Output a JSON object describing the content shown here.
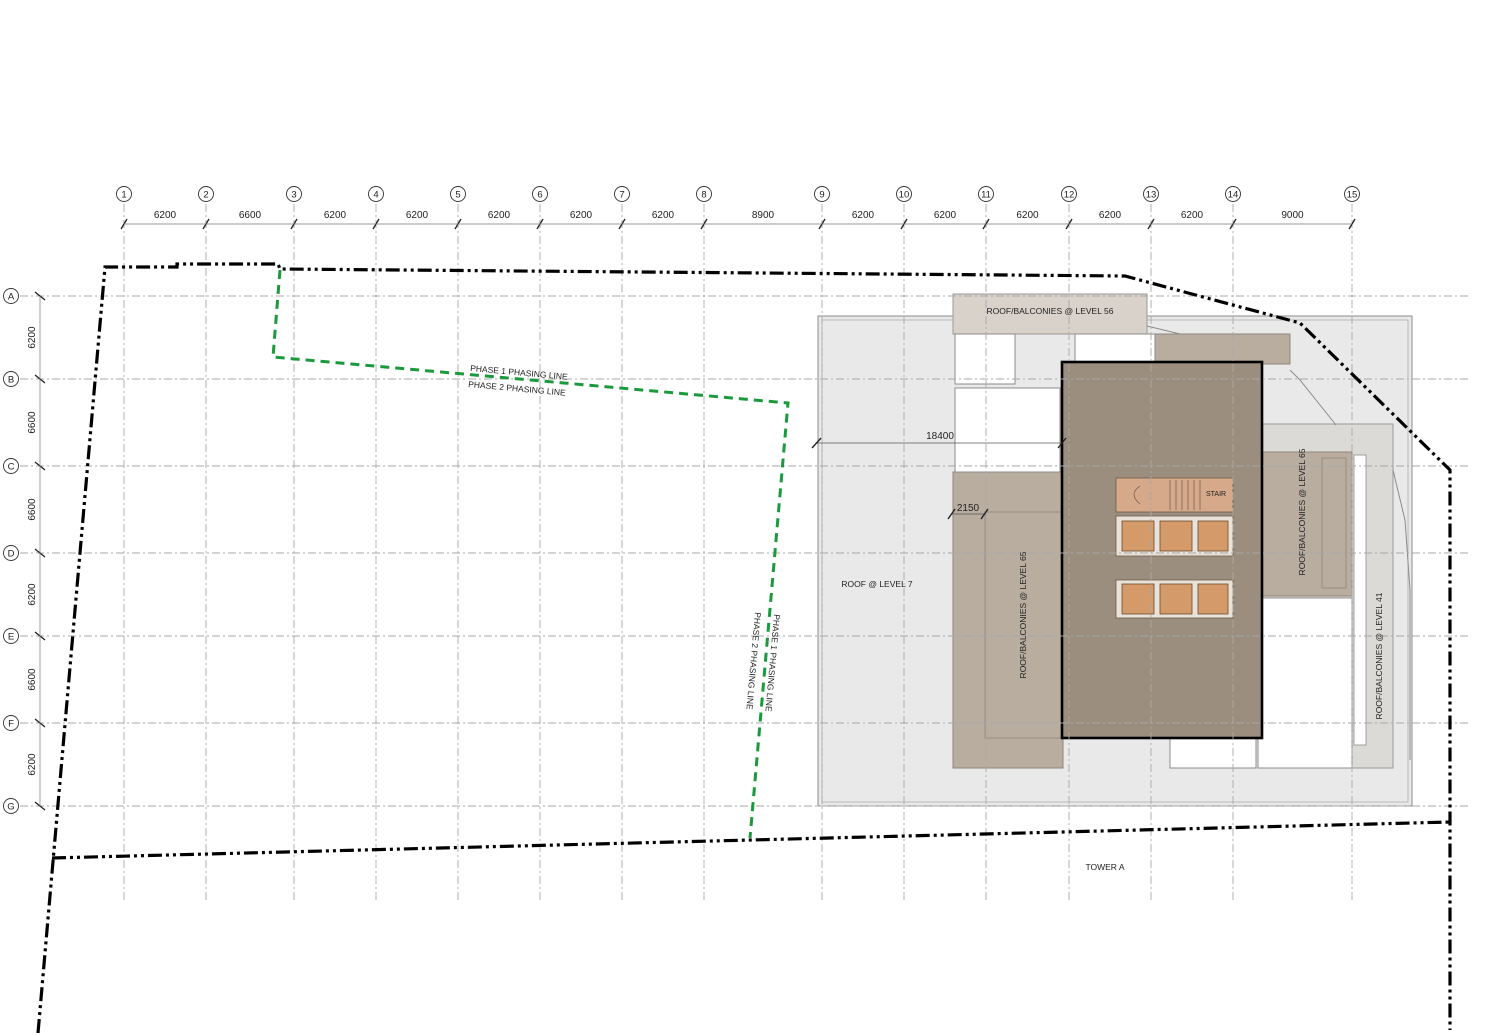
{
  "grid": {
    "columns": [
      "1",
      "2",
      "3",
      "4",
      "5",
      "6",
      "7",
      "8",
      "9",
      "10",
      "11",
      "12",
      "13",
      "14",
      "15"
    ],
    "column_spacings": [
      "6200",
      "6600",
      "6200",
      "6200",
      "6200",
      "6200",
      "6200",
      "8900",
      "6200",
      "6200",
      "6200",
      "6200",
      "6200",
      "9000"
    ],
    "rows": [
      "A",
      "B",
      "C",
      "D",
      "E",
      "F",
      "G"
    ],
    "row_spacings": [
      "6200",
      "6600",
      "6600",
      "6200",
      "6600",
      "6200"
    ]
  },
  "labels": {
    "roof_level_56": "ROOF/BALCONIES @ LEVEL 56",
    "roof_level_65_left": "ROOF/BALCONIES @ LEVEL 65",
    "roof_level_65_right": "ROOF/BALCONIES @ LEVEL 65",
    "roof_level_41": "ROOF/BALCONIES @ LEVEL 41",
    "roof_level_7": "ROOF @ LEVEL 7",
    "tower": "TOWER A",
    "stair": "STAIR"
  },
  "phasing": {
    "phase1": "PHASE 1 PHASING LINE",
    "phase2": "PHASE 2 PHASING LINE"
  },
  "dimensions": {
    "width_18400": "18400",
    "offset_2150": "2150"
  },
  "colors": {
    "phasing_line": "#1a9a3c",
    "tower_core": "#9c8e7e",
    "roof_level_65": "#b9ada0",
    "roof_level_56": "#d8d2ca",
    "roof_level_7": "#e9e9e9",
    "roof_level_41": "#dcdad6",
    "lift_cars": "#d49a6a",
    "grid_line": "#a8a8a8",
    "boundary": "#000000"
  }
}
